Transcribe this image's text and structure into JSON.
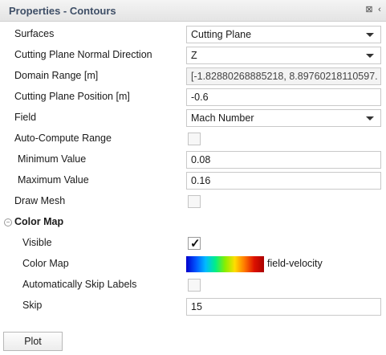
{
  "panel": {
    "title": "Properties - Contours"
  },
  "fields": {
    "surfaces": {
      "label": "Surfaces",
      "value": "Cutting Plane"
    },
    "normal": {
      "label": "Cutting Plane Normal Direction",
      "value": "Z"
    },
    "domain": {
      "label": "Domain Range [m]",
      "value": "[-1.82880268885218, 8.89760218110597..."
    },
    "position": {
      "label": "Cutting Plane Position [m]",
      "value": "-0.6"
    },
    "field": {
      "label": "Field",
      "value": "Mach Number"
    },
    "auto_range": {
      "label": "Auto-Compute Range",
      "checked": false
    },
    "min": {
      "label": "Minimum Value",
      "value": "0.08"
    },
    "max": {
      "label": "Maximum Value",
      "value": "0.16"
    },
    "draw_mesh": {
      "label": "Draw Mesh",
      "checked": false
    }
  },
  "color_map_section": {
    "title": "Color Map",
    "visible": {
      "label": "Visible",
      "checked": true
    },
    "color_map": {
      "label": "Color Map",
      "value": "field-velocity",
      "gradient_colors": [
        "#0000cc",
        "#0055ff",
        "#00bbff",
        "#00ee88",
        "#88ee00",
        "#ffdd00",
        "#ff7700",
        "#dd1100",
        "#aa0000"
      ]
    },
    "skip_labels": {
      "label": "Automatically Skip Labels",
      "checked": false
    },
    "skip": {
      "label": "Skip",
      "value": "15"
    }
  },
  "actions": {
    "plot_label": "Plot"
  }
}
